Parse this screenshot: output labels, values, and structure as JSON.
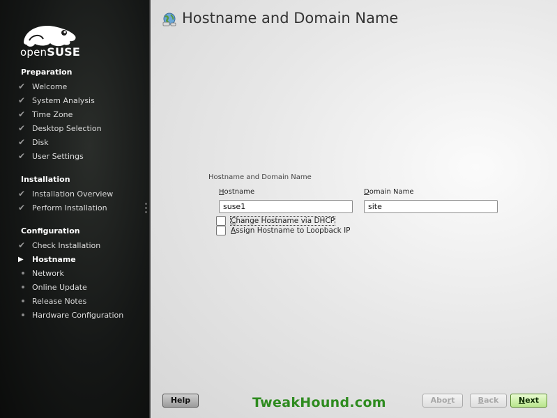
{
  "brand": {
    "prefix": "open",
    "suffix": "SUSE"
  },
  "sidebar": {
    "sections": [
      {
        "title": "Preparation",
        "steps": [
          {
            "label": "Welcome",
            "state": "done"
          },
          {
            "label": "System Analysis",
            "state": "done"
          },
          {
            "label": "Time Zone",
            "state": "done"
          },
          {
            "label": "Desktop Selection",
            "state": "done"
          },
          {
            "label": "Disk",
            "state": "done"
          },
          {
            "label": "User Settings",
            "state": "done"
          }
        ]
      },
      {
        "title": "Installation",
        "steps": [
          {
            "label": "Installation Overview",
            "state": "done"
          },
          {
            "label": "Perform Installation",
            "state": "done"
          }
        ]
      },
      {
        "title": "Configuration",
        "steps": [
          {
            "label": "Check Installation",
            "state": "done"
          },
          {
            "label": "Hostname",
            "state": "current"
          },
          {
            "label": "Network",
            "state": "pending"
          },
          {
            "label": "Online Update",
            "state": "pending"
          },
          {
            "label": "Release Notes",
            "state": "pending"
          },
          {
            "label": "Hardware Configuration",
            "state": "pending"
          }
        ]
      }
    ]
  },
  "main": {
    "title": "Hostname and Domain Name",
    "frame_label": "Hostname and Domain Name",
    "hostname": {
      "label_accel": "H",
      "label_rest": "ostname",
      "value": "suse1"
    },
    "domain": {
      "label_accel": "D",
      "label_rest": "omain Name",
      "value": "site"
    },
    "dhcp_checkbox": {
      "accel": "C",
      "rest": "hange Hostname via DHCP",
      "checked": false
    },
    "loopback_checkbox": {
      "accel": "A",
      "rest": "ssign Hostname to Loopback IP",
      "checked": false
    }
  },
  "buttons": {
    "help": "Help",
    "abort": {
      "accel_pre": "Abo",
      "accel": "r",
      "post": "t"
    },
    "back": {
      "accel": "B",
      "rest": "ack"
    },
    "next": {
      "accel": "N",
      "rest": "ext"
    }
  },
  "watermark": "TweakHound.com",
  "colors": {
    "accent_green": "#2e8b1f",
    "next_button": "#b8e58c"
  }
}
